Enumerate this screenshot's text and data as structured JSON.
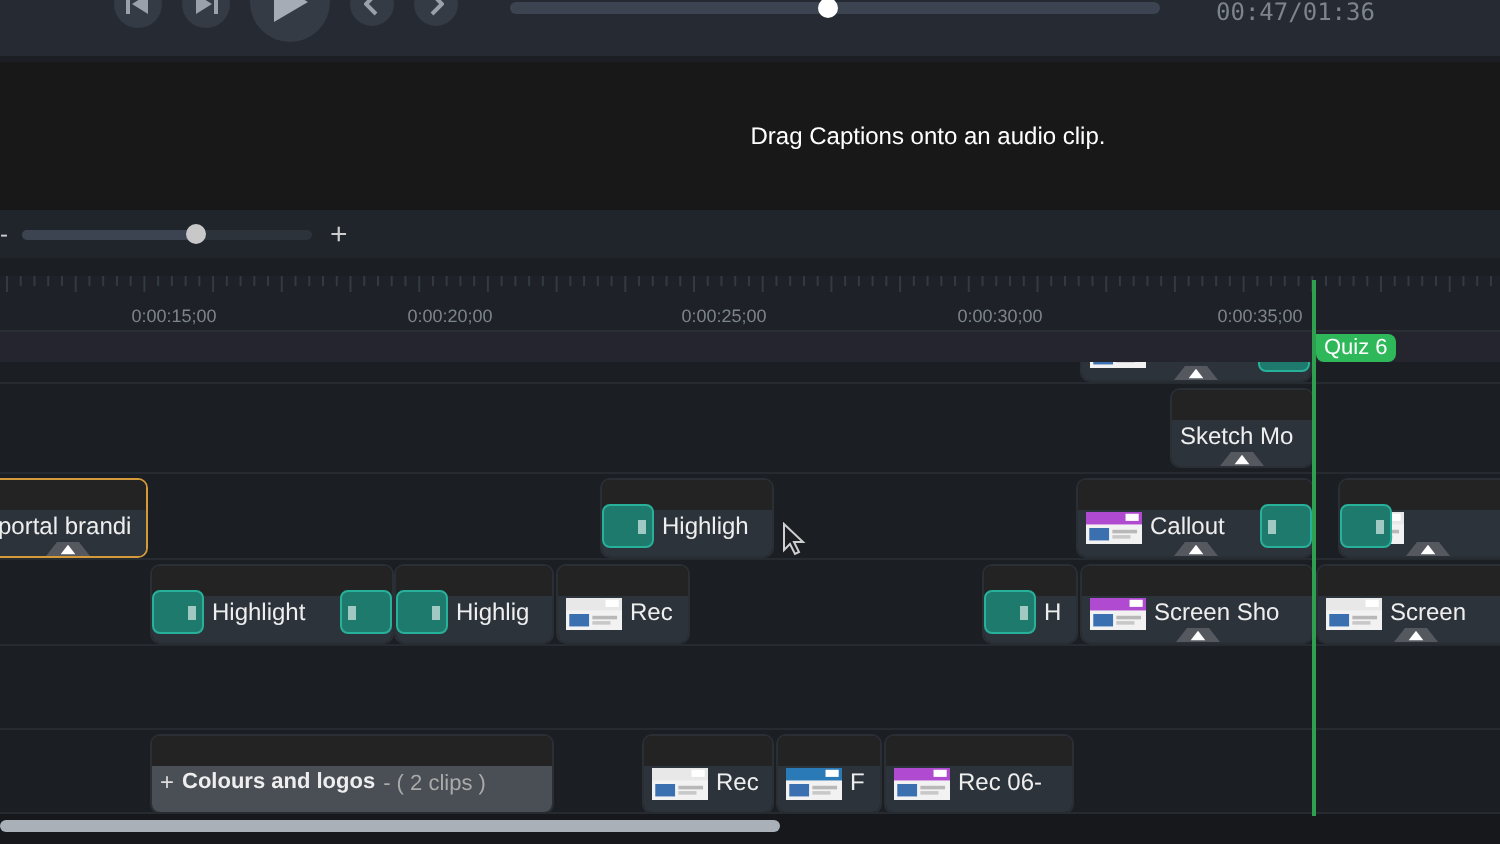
{
  "transport": {
    "seek": {
      "level": 0.49
    },
    "time": "00:47/01:36"
  },
  "captions": {
    "message": "Drag Captions onto an audio clip."
  },
  "zoom": {
    "minus": "-",
    "plus": "+",
    "level": 0.6
  },
  "ruler": {
    "labels": [
      "0:00:15;00",
      "0:00:20;00",
      "0:00:25;00",
      "0:00:30;00",
      "0:00:35;00"
    ]
  },
  "marker": {
    "label": "Quiz 6"
  },
  "tracks": [
    {
      "clips": [
        {
          "kind": "media",
          "effect": true,
          "selected": false,
          "left_handle": false,
          "right_handle": true
        }
      ]
    },
    {
      "clips": [
        {
          "kind": "plain",
          "label": "Sketch Mo",
          "effect": true,
          "selected": false,
          "left_handle": false,
          "right_handle": false
        }
      ]
    },
    {
      "clips": [
        {
          "kind": "plain",
          "label": "portal brandi",
          "effect": true,
          "selected": true,
          "left_handle": false,
          "right_handle": false
        },
        {
          "kind": "plain",
          "label": "Highligh",
          "effect": false,
          "selected": false,
          "left_handle": true,
          "right_handle": false
        },
        {
          "kind": "media",
          "label": "Callout",
          "effect": true,
          "selected": false,
          "left_handle": false,
          "right_handle": true
        },
        {
          "kind": "media",
          "effect": true,
          "selected": false,
          "left_handle": true,
          "right_handle": false
        }
      ]
    },
    {
      "clips": [
        {
          "kind": "plain",
          "label": "Highlight",
          "effect": false,
          "selected": false,
          "left_handle": true,
          "right_handle": true
        },
        {
          "kind": "plain",
          "label": "Highlig",
          "effect": false,
          "selected": false,
          "left_handle": true,
          "right_handle": false
        },
        {
          "kind": "media",
          "label": "Rec",
          "effect": false,
          "selected": false,
          "left_handle": false,
          "right_handle": false
        },
        {
          "kind": "plain",
          "label": "H",
          "effect": false,
          "selected": false,
          "left_handle": true,
          "right_handle": false
        },
        {
          "kind": "media",
          "label": "Screen Sho",
          "effect": true,
          "selected": false,
          "left_handle": false,
          "right_handle": false
        },
        {
          "kind": "media",
          "label": "Screen",
          "effect": true,
          "selected": false,
          "left_handle": false,
          "right_handle": false
        }
      ]
    },
    {
      "clips": [
        {
          "kind": "group",
          "expand": "+",
          "label": "Colours and logos",
          "count": "- ( 2 clips )",
          "effect": false,
          "selected": false,
          "left_handle": false,
          "right_handle": false
        },
        {
          "kind": "media",
          "label": "Rec",
          "effect": false,
          "selected": false,
          "left_handle": false,
          "right_handle": false
        },
        {
          "kind": "media",
          "label": "F",
          "effect": false,
          "selected": false,
          "left_handle": false,
          "right_handle": false
        },
        {
          "kind": "media",
          "label": "Rec 06-",
          "effect": false,
          "selected": false,
          "left_handle": false,
          "right_handle": false
        }
      ]
    }
  ]
}
